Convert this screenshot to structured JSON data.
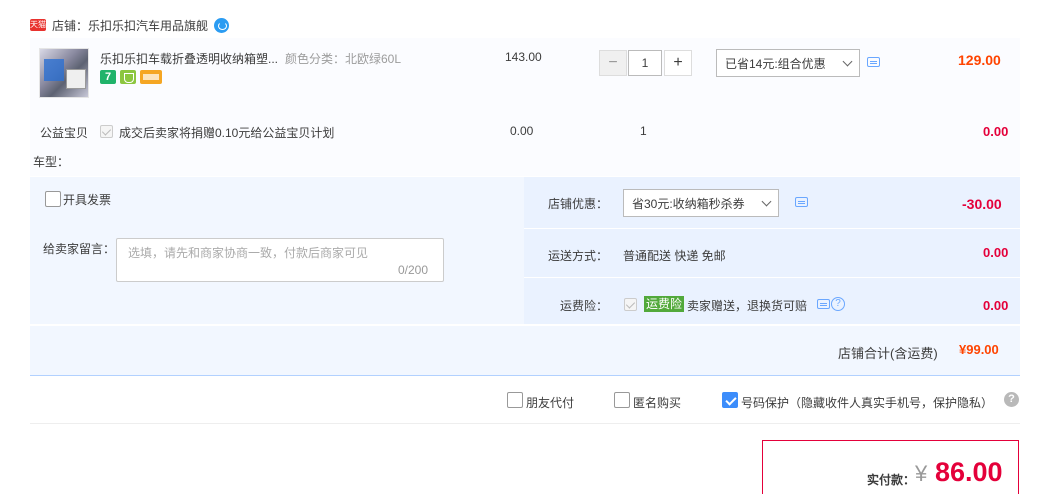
{
  "shop": {
    "badge": "天猫",
    "label": "店铺：乐扣乐扣汽车用品旗舰"
  },
  "item": {
    "title": "乐扣乐扣车载折叠透明收纳箱塑...",
    "sku": "颜色分类：北欧绿60L",
    "price": "143.00",
    "quantity": "1",
    "minus": "−",
    "plus": "+",
    "promo": "已省14元:组合优惠",
    "subtotal": "129.00",
    "icon7": "7"
  },
  "charity": {
    "label": "公益宝贝",
    "text": "成交后卖家将捐赠0.10元给公益宝贝计划",
    "price": "0.00",
    "quantity": "1",
    "amount": "0.00"
  },
  "car_type": {
    "label": "车型："
  },
  "invoice": {
    "label": "开具发票"
  },
  "message": {
    "label": "给卖家留言：",
    "placeholder": "选填，请先和商家协商一致，付款后商家可见",
    "count": "0/200"
  },
  "shop_discount": {
    "label": "店铺优惠：",
    "value": "省30元:收纳箱秒杀券",
    "amount": "-30.00"
  },
  "shipping": {
    "label": "运送方式：",
    "value": "普通配送 快递 免邮",
    "amount": "0.00"
  },
  "insurance": {
    "label": "运费险：",
    "badge": "运费险",
    "text": "卖家赠送，退换货可赔",
    "amount": "0.00",
    "help": "?"
  },
  "total": {
    "label": "店铺合计(含运费)",
    "amount": "¥99.00"
  },
  "options": {
    "friend_pay": "朋友代付",
    "anonymous": "匿名购买",
    "number_protect": "号码保护（隐藏收件人真实手机号，保护隐私）",
    "help": "?"
  },
  "payment": {
    "label": "实付款：",
    "currency": "¥",
    "amount": "86.00"
  }
}
